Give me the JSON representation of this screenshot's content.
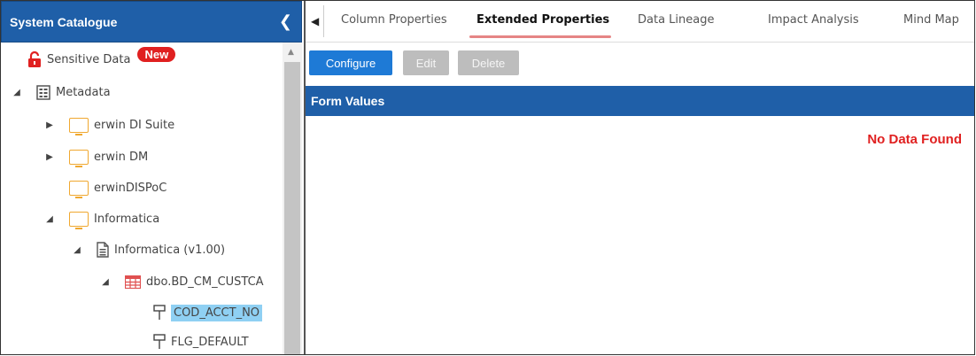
{
  "left_panel": {
    "title": "System Catalogue",
    "collapse_glyph": "❮",
    "tree": [
      {
        "label": "Sensitive Data",
        "icon": "lock-icon",
        "badge": "New"
      },
      {
        "label": "Metadata",
        "icon": "metadata-icon",
        "toggle": "◢"
      },
      {
        "label": "erwin DI Suite",
        "icon": "system-icon",
        "toggle": "▶"
      },
      {
        "label": "erwin DM",
        "icon": "system-icon",
        "toggle": "▶"
      },
      {
        "label": "erwinDISPoC",
        "icon": "system-icon"
      },
      {
        "label": "Informatica",
        "icon": "system-icon",
        "toggle": "◢"
      },
      {
        "label": "Informatica (v1.00)",
        "icon": "environment-icon",
        "toggle": "◢"
      },
      {
        "label": "dbo.BD_CM_CUSTCA",
        "icon": "table-icon",
        "toggle": "◢"
      },
      {
        "label": "COD_ACCT_NO",
        "icon": "column-icon",
        "selected": true
      },
      {
        "label": "FLG_DEFAULT",
        "icon": "column-icon"
      }
    ]
  },
  "tabs": [
    "Column Properties",
    "Extended Properties",
    "Data Lineage",
    "Impact Analysis",
    "Mind Map"
  ],
  "active_tab": "Extended Properties",
  "toolbar": {
    "configure_label": "Configure",
    "edit_label": "Edit",
    "delete_label": "Delete"
  },
  "form": {
    "title": "Form Values",
    "empty_message": "No Data Found"
  },
  "colors": {
    "header_blue": "#1f5fa8",
    "button_blue": "#1e7ad6",
    "badge_red": "#e02020",
    "selection": "#8fd0f3",
    "system_icon": "#f0a830"
  }
}
